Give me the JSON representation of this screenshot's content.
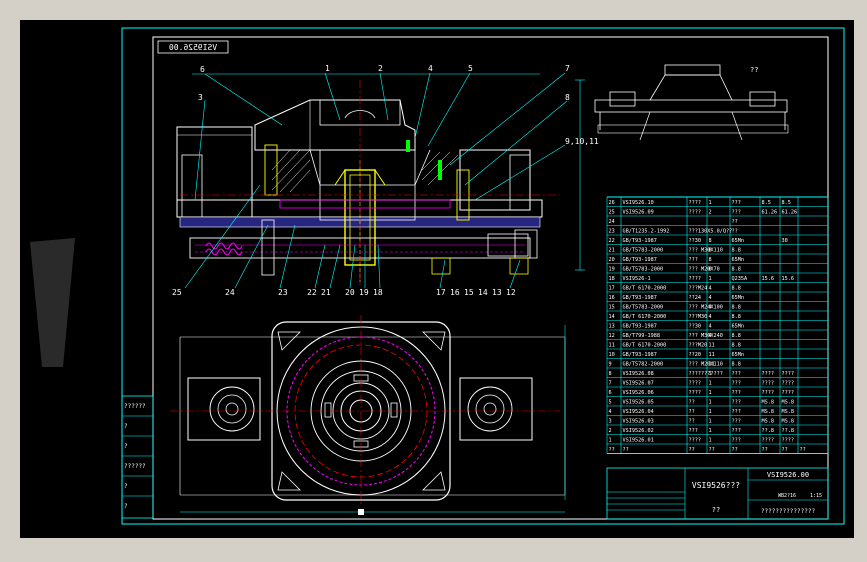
{
  "drawing": {
    "mirrored_label": "VSI9526.00",
    "top_view_label": "??",
    "title_block_label": "VSI9526???",
    "drawing_no": "VSI9526.00",
    "footer_text": "??",
    "footer_text_2": "???????????????",
    "scale": "1:15",
    "sheet": "WB2?16"
  },
  "left_margin_labels": [
    "??????",
    "?",
    "?",
    "??????",
    "?",
    "?"
  ],
  "callouts": {
    "top": [
      "1",
      "2",
      "4",
      "5",
      "6",
      "7",
      "3",
      "8",
      "9,10,11"
    ],
    "bottom": [
      "25",
      "24",
      "23",
      "22",
      "21",
      "20",
      "19",
      "18",
      "17",
      "16",
      "15",
      "14",
      "13",
      "12"
    ]
  },
  "bom_rows": [
    {
      "no": "26",
      "code": "VSI9526.10",
      "name": "????",
      "qty": "1",
      "mat": "???",
      "w1": "8.5",
      "w2": "8.5"
    },
    {
      "no": "25",
      "code": "VSI9526.09",
      "name": "????",
      "qty": "2",
      "mat": "???",
      "w1": "61.26",
      "w2": "61.26"
    },
    {
      "no": "24",
      "code": "",
      "name": "",
      "qty": "",
      "mat": "??",
      "w1": "",
      "w2": ""
    },
    {
      "no": "23",
      "code": "GB/T1235.2-1992",
      "name": "???130X5.0/Q??",
      "qty": "",
      "mat": "??",
      "w1": "",
      "w2": ""
    },
    {
      "no": "22",
      "code": "GB/T93-1987",
      "name": "??30",
      "qty": "8",
      "mat": "65Mn",
      "w1": "",
      "w2": "30"
    },
    {
      "no": "21",
      "code": "GB/T5783-2000",
      "name": "??? M30X110",
      "qty": "8",
      "mat": "8.8",
      "w1": "",
      "w2": ""
    },
    {
      "no": "20",
      "code": "GB/T93-1987",
      "name": "???",
      "qty": "8",
      "mat": "65Mn",
      "w1": "",
      "w2": ""
    },
    {
      "no": "19",
      "code": "GB/T5783-2000",
      "name": "??? M20X70",
      "qty": "8",
      "mat": "8.8",
      "w1": "",
      "w2": ""
    },
    {
      "no": "18",
      "code": "VSI9526-1",
      "name": "????",
      "qty": "1",
      "mat": "Q235A",
      "w1": "15.6",
      "w2": "15.6"
    },
    {
      "no": "17",
      "code": "GB/T 6170-2000",
      "name": "???M24",
      "qty": "4",
      "mat": "8.8",
      "w1": "",
      "w2": ""
    },
    {
      "no": "16",
      "code": "GB/T93-1987",
      "name": "??24",
      "qty": "4",
      "mat": "65Mn",
      "w1": "",
      "w2": ""
    },
    {
      "no": "15",
      "code": "GB/T5783-2000",
      "name": "??? M24X100",
      "qty": "4",
      "mat": "8.8",
      "w1": "",
      "w2": ""
    },
    {
      "no": "14",
      "code": "GB/T 6170-2000",
      "name": "???M30",
      "qty": "4",
      "mat": "8.8",
      "w1": "",
      "w2": ""
    },
    {
      "no": "13",
      "code": "GB/T93-1987",
      "name": "??30",
      "qty": "4",
      "mat": "65Mn",
      "w1": "",
      "w2": ""
    },
    {
      "no": "12",
      "code": "GB/T799-1988",
      "name": "??? M30X240",
      "qty": "4",
      "mat": "8.8",
      "w1": "",
      "w2": ""
    },
    {
      "no": "11",
      "code": "GB/T 6170-2000",
      "name": "???M20",
      "qty": "11",
      "mat": "8.8",
      "w1": "",
      "w2": ""
    },
    {
      "no": "10",
      "code": "GB/T93-1987",
      "name": "??20",
      "qty": "11",
      "mat": "65Mn",
      "w1": "",
      "w2": ""
    },
    {
      "no": "9",
      "code": "GB/T5782-2000",
      "name": "??? M20X110",
      "qty": "11",
      "mat": "8.8",
      "w1": "",
      "w2": ""
    },
    {
      "no": "8",
      "code": "VSI9526.08",
      "name": "???????????",
      "qty": "1",
      "mat": "???",
      "w1": "????",
      "w2": "????"
    },
    {
      "no": "7",
      "code": "VSI9526.07",
      "name": "????",
      "qty": "1",
      "mat": "???",
      "w1": "????",
      "w2": "????"
    },
    {
      "no": "6",
      "code": "VSI9526.06",
      "name": "????",
      "qty": "1",
      "mat": "???",
      "w1": "????",
      "w2": "????"
    },
    {
      "no": "5",
      "code": "VSI9526.05",
      "name": "??",
      "qty": "1",
      "mat": "???",
      "w1": "MS.8",
      "w2": "MS.8"
    },
    {
      "no": "4",
      "code": "VSI9526.04",
      "name": "??",
      "qty": "1",
      "mat": "???",
      "w1": "MS.8",
      "w2": "MS.8"
    },
    {
      "no": "3",
      "code": "VSI9526.03",
      "name": "??",
      "qty": "1",
      "mat": "???",
      "w1": "MS.8",
      "w2": "MS.8"
    },
    {
      "no": "2",
      "code": "VSI9526.02",
      "name": "???",
      "qty": "1",
      "mat": "???",
      "w1": "??.8",
      "w2": "??.8"
    },
    {
      "no": "1",
      "code": "VSI9526.01",
      "name": "????",
      "qty": "1",
      "mat": "???",
      "w1": "????",
      "w2": "????"
    }
  ],
  "bom_header": [
    "??",
    "??",
    "??",
    "??",
    "??",
    "??",
    "??",
    "??"
  ],
  "colors": {
    "sheet": "#00ffff",
    "section": "#ffffff",
    "shaft": "#ffff00",
    "center": "#ff0000",
    "magenta": "#ff00ff",
    "accent": "#00ff00"
  }
}
